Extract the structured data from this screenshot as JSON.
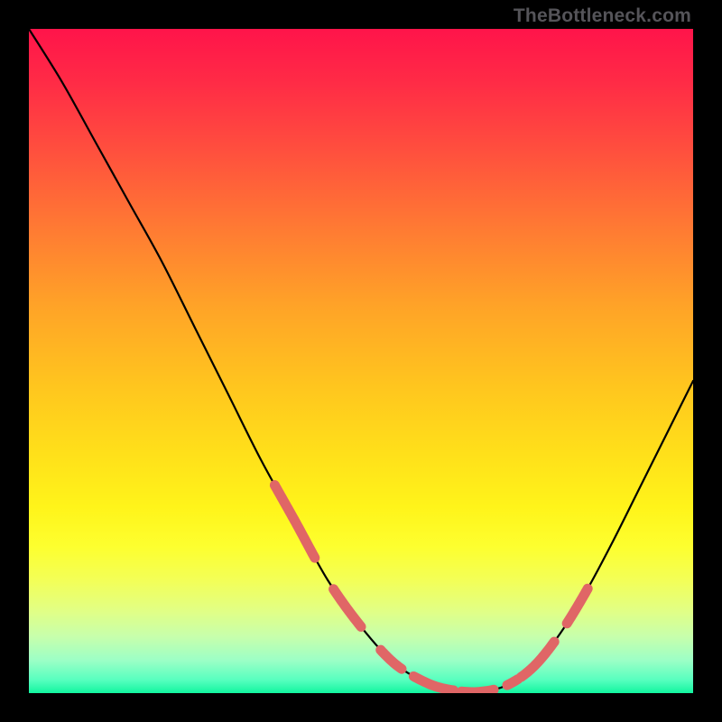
{
  "watermark": "TheBottleneck.com",
  "chart_data": {
    "type": "line",
    "title": "",
    "xlabel": "",
    "ylabel": "",
    "xlim": [
      0,
      100
    ],
    "ylim": [
      0,
      100
    ],
    "grid": false,
    "legend": false,
    "series": [
      {
        "name": "bottleneck-curve",
        "x": [
          0,
          5,
          10,
          15,
          20,
          25,
          30,
          35,
          40,
          45,
          50,
          55,
          60,
          64,
          68,
          72,
          76,
          80,
          84,
          88,
          92,
          96,
          100
        ],
        "y": [
          100,
          92,
          83,
          74,
          65,
          55,
          45,
          35,
          26,
          17,
          10,
          4.5,
          1.5,
          0.4,
          0.2,
          1.2,
          4,
          9,
          15.5,
          23,
          31,
          39,
          47
        ]
      }
    ],
    "markers": {
      "name": "pink-segments",
      "color": "#e06666",
      "segments_x_pct": [
        [
          37,
          43
        ],
        [
          46,
          50
        ],
        [
          53,
          56
        ],
        [
          58,
          64
        ],
        [
          65,
          70
        ],
        [
          72,
          73.5
        ],
        [
          74.2,
          79
        ],
        [
          81,
          84
        ]
      ]
    },
    "background": {
      "type": "vertical-gradient",
      "stops": [
        {
          "pct": 0,
          "color": "#ff144a"
        },
        {
          "pct": 50,
          "color": "#ffc61e"
        },
        {
          "pct": 80,
          "color": "#fdff2f"
        },
        {
          "pct": 100,
          "color": "#12f59f"
        }
      ]
    }
  }
}
